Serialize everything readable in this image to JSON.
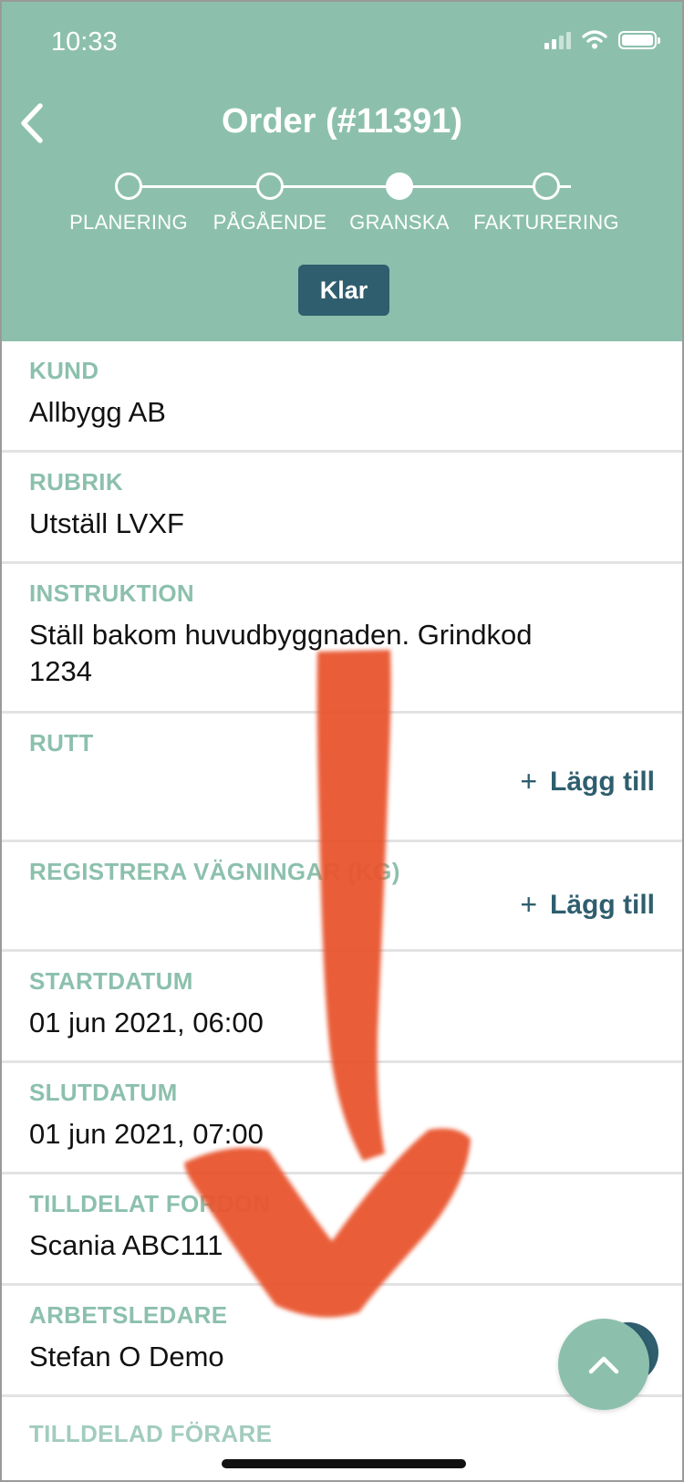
{
  "status_bar": {
    "time": "10:33"
  },
  "header": {
    "title": "Order (#11391)",
    "steps": [
      {
        "label": "PLANERING",
        "active": false
      },
      {
        "label": "PÅGÅENDE",
        "active": false
      },
      {
        "label": "GRANSKA",
        "active": true
      },
      {
        "label": "FAKTURERING",
        "active": false
      }
    ],
    "done_button": "Klar"
  },
  "fields": {
    "kund": {
      "label": "KUND",
      "value": "Allbygg AB"
    },
    "rubrik": {
      "label": "RUBRIK",
      "value": "Utställ LVXF"
    },
    "instruktion": {
      "label": "INSTRUKTION",
      "value_line1": "Ställ bakom huvudbyggnaden. Grindkod",
      "value_line2": "1234"
    },
    "rutt": {
      "label": "RUTT",
      "add_label": "Lägg till"
    },
    "vagningar": {
      "label": "REGISTRERA VÄGNINGAR (KG)",
      "add_label": "Lägg till"
    },
    "startdatum": {
      "label": "STARTDATUM",
      "value": "01 jun 2021, 06:00"
    },
    "slutdatum": {
      "label": "SLUTDATUM",
      "value": "01 jun 2021, 07:00"
    },
    "tilldelat_fordon": {
      "label": "TILLDELAT FORDON",
      "value": "Scania ABC111"
    },
    "arbetsledare": {
      "label": "ARBETSLEDARE",
      "value": "Stefan O Demo"
    },
    "tilldelad_forare": {
      "label": "TILLDELAD FÖRARE"
    }
  },
  "colors": {
    "brand": "#8cc0ad",
    "accent_dark": "#2f5e6e",
    "annotation": "#e8542f"
  },
  "icons": [
    "back-chevron-icon",
    "signal-icon",
    "wifi-icon",
    "battery-icon",
    "plus-icon",
    "chevron-up-icon",
    "arrow-down-annotation"
  ]
}
